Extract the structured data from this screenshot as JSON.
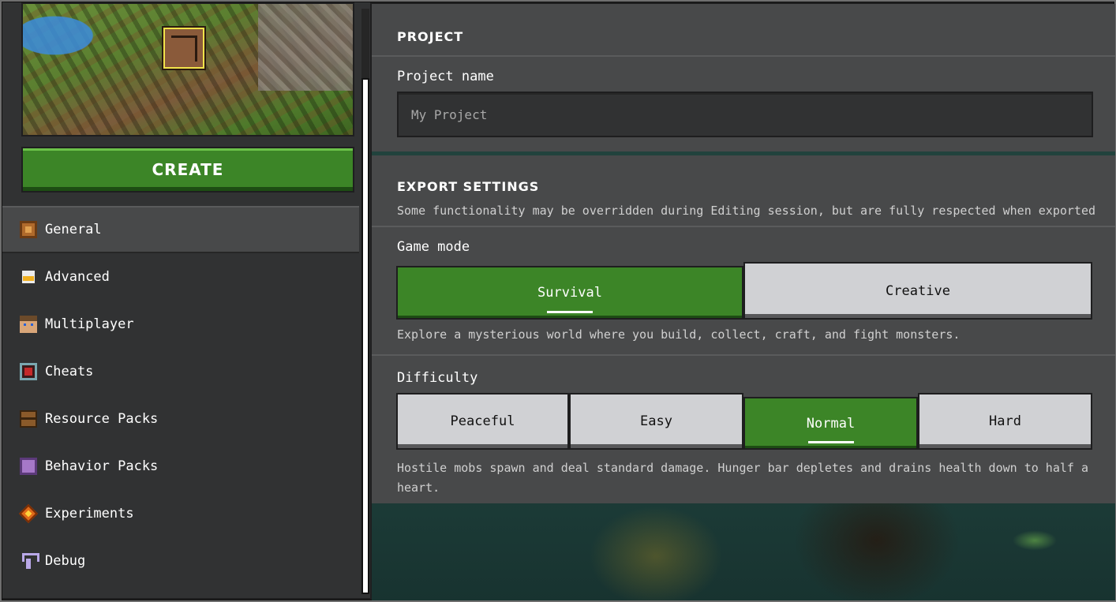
{
  "sidebar": {
    "create_label": "CREATE",
    "items": [
      {
        "label": "General",
        "icon": "gear-icon",
        "active": true
      },
      {
        "label": "Advanced",
        "icon": "advanced-icon"
      },
      {
        "label": "Multiplayer",
        "icon": "player-face-icon"
      },
      {
        "label": "Cheats",
        "icon": "cheats-icon"
      },
      {
        "label": "Resource Packs",
        "icon": "chest-icon"
      },
      {
        "label": "Behavior Packs",
        "icon": "behavior-pack-icon"
      },
      {
        "label": "Experiments",
        "icon": "experiments-icon"
      },
      {
        "label": "Debug",
        "icon": "debug-icon"
      }
    ]
  },
  "project": {
    "header": "PROJECT",
    "name_label": "Project name",
    "name_placeholder": "My Project"
  },
  "export": {
    "header": "EXPORT SETTINGS",
    "subtitle": "Some functionality may be overridden during Editing session, but are fully respected when exported",
    "game_mode": {
      "label": "Game mode",
      "options": [
        "Survival",
        "Creative"
      ],
      "selected": "Survival",
      "description": "Explore a mysterious world where you build, collect, craft, and fight monsters."
    },
    "difficulty": {
      "label": "Difficulty",
      "options": [
        "Peaceful",
        "Easy",
        "Normal",
        "Hard"
      ],
      "selected": "Normal",
      "description": "Hostile mobs spawn and deal standard damage. Hunger bar depletes and drains health down to half a heart."
    }
  },
  "colors": {
    "accent_green": "#3c8527",
    "panel": "#48494a",
    "sidebar": "#313233",
    "button_off": "#d0d1d4"
  }
}
